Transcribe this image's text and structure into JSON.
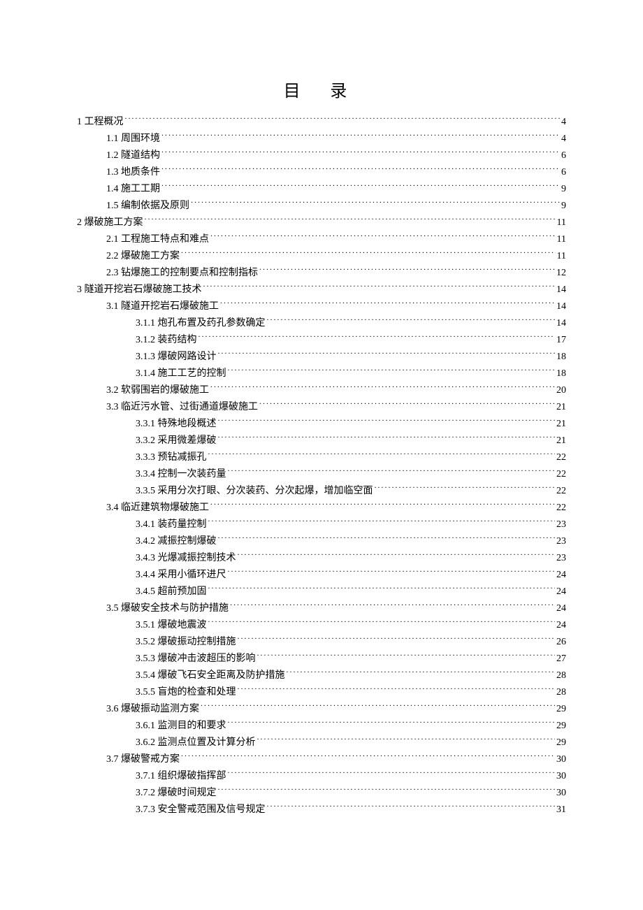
{
  "title": "目 录",
  "toc": [
    {
      "level": 1,
      "label": "1 工程概况",
      "page": "4"
    },
    {
      "level": 2,
      "label": "1.1 周围环境",
      "page": "4"
    },
    {
      "level": 2,
      "label": "1.2 隧道结构",
      "page": "6"
    },
    {
      "level": 2,
      "label": "1.3 地质条件",
      "page": "6"
    },
    {
      "level": 2,
      "label": "1.4 施工工期",
      "page": "9"
    },
    {
      "level": 2,
      "label": "1.5 编制依据及原则",
      "page": "9"
    },
    {
      "level": 1,
      "label": "2 爆破施工方案",
      "page": "11"
    },
    {
      "level": 2,
      "label": "2.1 工程施工特点和难点",
      "page": "11"
    },
    {
      "level": 2,
      "label": "2.2 爆破施工方案",
      "page": "11"
    },
    {
      "level": 2,
      "label": "2.3 钻爆施工的控制要点和控制指标",
      "page": "12"
    },
    {
      "level": 1,
      "label": "3 隧道开挖岩石爆破施工技术",
      "page": "14"
    },
    {
      "level": 2,
      "label": "3.1 隧道开挖岩石爆破施工",
      "page": "14"
    },
    {
      "level": 3,
      "label": "3.1.1 炮孔布置及药孔参数确定",
      "page": "14"
    },
    {
      "level": 3,
      "label": "3.1.2 装药结构",
      "page": "17"
    },
    {
      "level": 3,
      "label": "3.1.3 爆破网路设计",
      "page": "18"
    },
    {
      "level": 3,
      "label": "3.1.4 施工工艺的控制",
      "page": "18"
    },
    {
      "level": 2,
      "label": "3.2 软弱围岩的爆破施工",
      "page": "20"
    },
    {
      "level": 2,
      "label": "3.3 临近污水管、过街通道爆破施工",
      "page": "21"
    },
    {
      "level": 3,
      "label": "3.3.1 特殊地段概述",
      "page": "21"
    },
    {
      "level": 3,
      "label": "3.3.2 采用微差爆破",
      "page": "21"
    },
    {
      "level": 3,
      "label": "3.3.3 预钻减振孔",
      "page": "22"
    },
    {
      "level": 3,
      "label": "3.3.4 控制一次装药量",
      "page": "22"
    },
    {
      "level": 3,
      "label": "3.3.5 采用分次打眼、分次装药、分次起爆，增加临空面",
      "page": "22"
    },
    {
      "level": 2,
      "label": "3.4 临近建筑物爆破施工",
      "page": "22"
    },
    {
      "level": 3,
      "label": "3.4.1 装药量控制",
      "page": "23"
    },
    {
      "level": 3,
      "label": "3.4.2 减振控制爆破",
      "page": "23"
    },
    {
      "level": 3,
      "label": "3.4.3 光爆减振控制技术",
      "page": "23"
    },
    {
      "level": 3,
      "label": "3.4.4 采用小循环进尺",
      "page": "24"
    },
    {
      "level": 3,
      "label": "3.4.5 超前预加固",
      "page": "24"
    },
    {
      "level": 2,
      "label": "3.5 爆破安全技术与防护措施",
      "page": "24"
    },
    {
      "level": 3,
      "label": "3.5.1 爆破地震波",
      "page": "24"
    },
    {
      "level": 3,
      "label": "3.5.2 爆破振动控制措施",
      "page": "26"
    },
    {
      "level": 3,
      "label": "3.5.3 爆破冲击波超压的影响",
      "page": "27"
    },
    {
      "level": 3,
      "label": "3.5.4 爆破飞石安全距离及防护措施",
      "page": "28"
    },
    {
      "level": 3,
      "label": "3.5.5 盲炮的检查和处理",
      "page": "28"
    },
    {
      "level": 2,
      "label": "3.6 爆破振动监测方案",
      "page": "29"
    },
    {
      "level": 3,
      "label": "3.6.1 监测目的和要求",
      "page": "29"
    },
    {
      "level": 3,
      "label": "3.6.2 监测点位置及计算分析",
      "page": "29"
    },
    {
      "level": 2,
      "label": "3.7 爆破警戒方案",
      "page": "30"
    },
    {
      "level": 3,
      "label": "3.7.1 组织爆破指挥部",
      "page": "30"
    },
    {
      "level": 3,
      "label": "3.7.2 爆破时间规定",
      "page": "30"
    },
    {
      "level": 3,
      "label": "3.7.3 安全警戒范围及信号规定",
      "page": "31"
    }
  ]
}
